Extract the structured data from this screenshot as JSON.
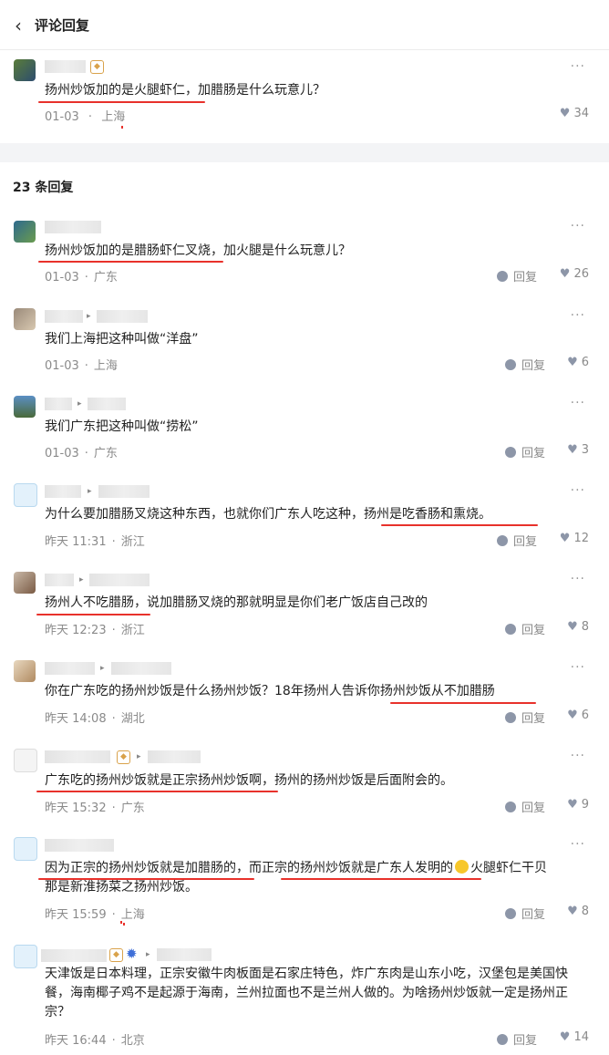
{
  "header": {
    "back_icon": "chevron-left-icon",
    "title": "评论回复"
  },
  "original": {
    "text": "扬州炒饭加的是火腿虾仁，加腊肠是什么玩意儿？",
    "date": "01-03",
    "location": "上海",
    "likes": "34"
  },
  "replies_header": "23 条回复",
  "reply_label": "回复",
  "separator": "·",
  "replies": [
    {
      "text": "扬州炒饭加的是腊肠虾仁叉烧，加火腿是什么玩意儿？",
      "date": "01-03",
      "location": "广东",
      "likes": "26"
    },
    {
      "text": "我们上海把这种叫做“洋盘”",
      "date": "01-03",
      "location": "上海",
      "likes": "6"
    },
    {
      "text": "我们广东把这种叫做“捞松”",
      "date": "01-03",
      "location": "广东",
      "likes": "3"
    },
    {
      "text": "为什么要加腊肠叉烧这种东西，也就你们广东人吃这种，扬州是吃香肠和熏烧。",
      "date": "昨天 11:31",
      "location": "浙江",
      "likes": "12"
    },
    {
      "text": "扬州人不吃腊肠，说加腊肠叉烧的那就明显是你们老广饭店自己改的",
      "date": "昨天 12:23",
      "location": "浙江",
      "likes": "8"
    },
    {
      "text": "你在广东吃的扬州炒饭是什么扬州炒饭？18年扬州人告诉你扬州炒饭从不加腊肠",
      "date": "昨天 14:08",
      "location": "湖北",
      "likes": "6"
    },
    {
      "text": "广东吃的扬州炒饭就是正宗扬州炒饭啊，扬州的扬州炒饭是后面附会的。",
      "date": "昨天 15:32",
      "location": "广东",
      "likes": "9"
    },
    {
      "text_a": "因为正宗的扬州炒饭就是加腊肠的，而正宗的扬州炒饭就是广东人发明的",
      "text_b": "火腿虾仁干贝",
      "text_c": "那是新淮扬菜之扬州炒饭。",
      "date": "昨天 15:59",
      "location": "上海",
      "likes": "8"
    },
    {
      "text": "天津饭是日本料理，正宗安徽牛肉板面是石家庄特色，炸广东肉是山东小吃，汉堡包是美国快餐，海南椰子鸡不是起源于海南，兰州拉面也不是兰州人做的。为啥扬州炒饭就一定是扬州正宗？",
      "date": "昨天 16:44",
      "location": "北京",
      "likes": "14"
    }
  ]
}
